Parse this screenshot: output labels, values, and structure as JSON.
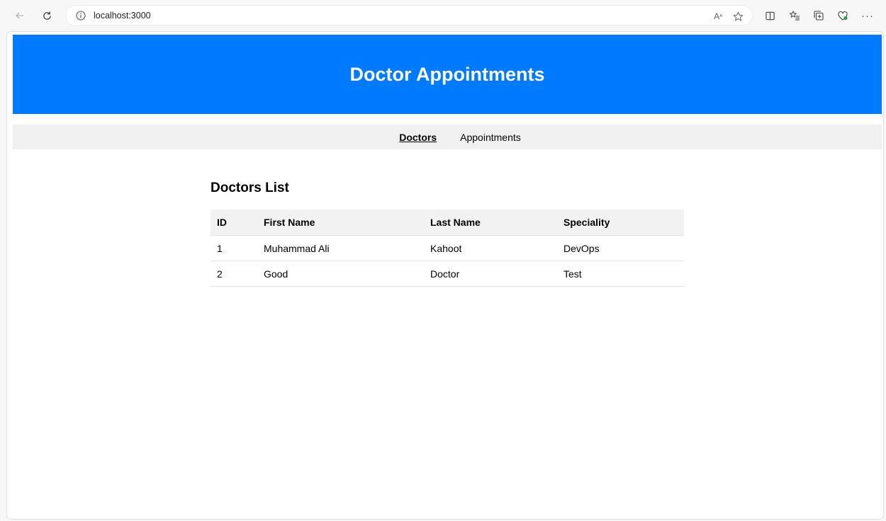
{
  "browser": {
    "url": "localhost:3000",
    "icons": [
      "back-icon",
      "refresh-icon",
      "info-icon",
      "read-aloud-icon",
      "favorite-star-icon",
      "split-screen-icon",
      "favorites-icon",
      "collections-icon",
      "browser-essentials-icon",
      "more-icon"
    ]
  },
  "site": {
    "title": "Doctor Appointments",
    "header_color": "#007bff"
  },
  "nav": {
    "items": [
      {
        "label": "Doctors",
        "active": true
      },
      {
        "label": "Appointments",
        "active": false
      }
    ]
  },
  "main": {
    "heading": "Doctors List",
    "table": {
      "columns": [
        "ID",
        "First Name",
        "Last Name",
        "Speciality"
      ],
      "rows": [
        [
          "1",
          "Muhammad Ali",
          "Kahoot",
          "DevOps"
        ],
        [
          "2",
          "Good",
          "Doctor",
          "Test"
        ]
      ]
    }
  }
}
